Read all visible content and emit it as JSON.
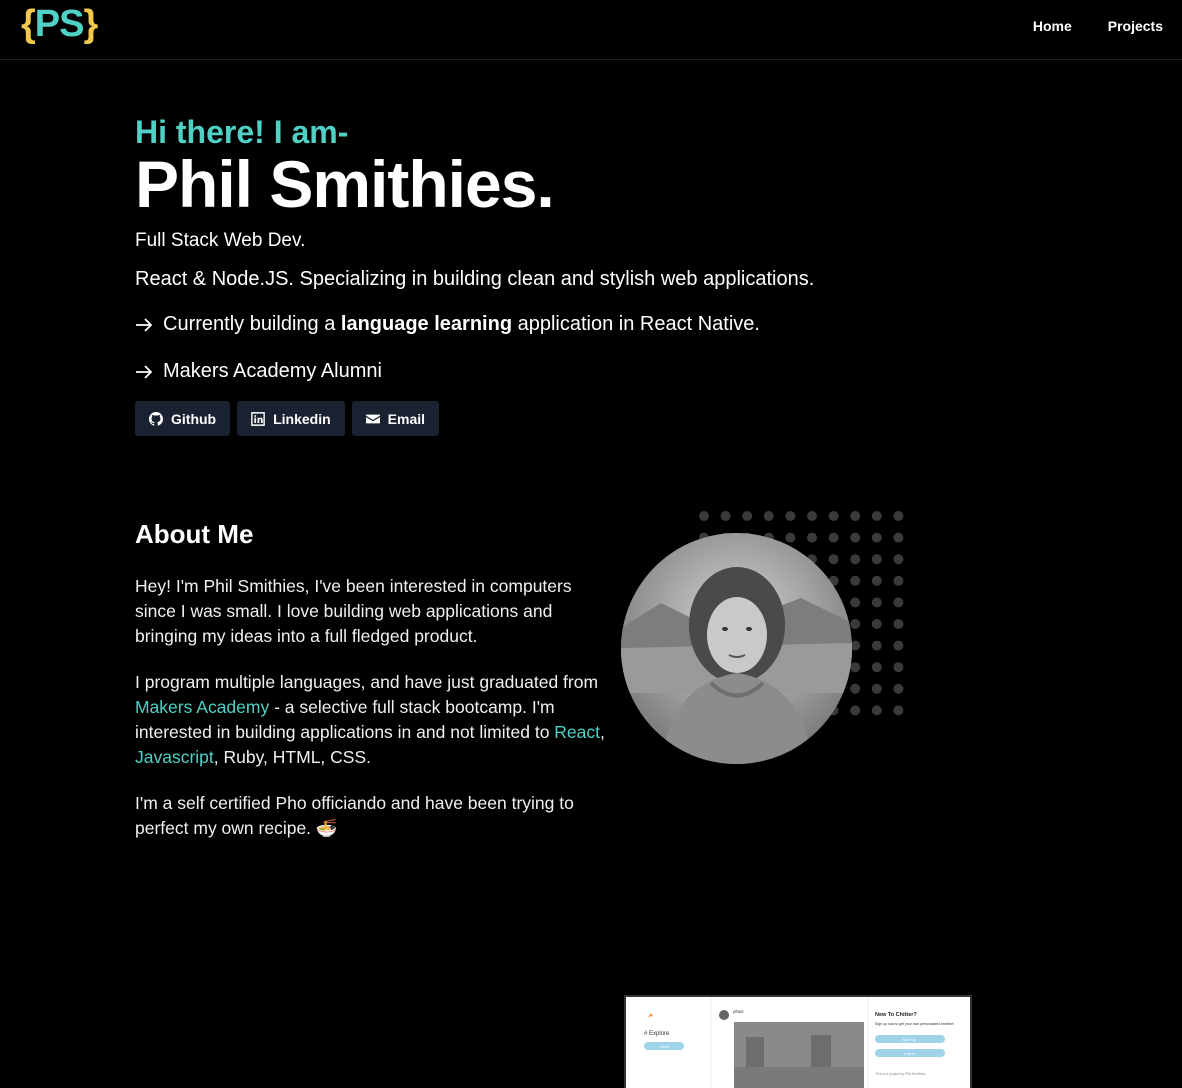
{
  "nav": {
    "logo_open": "{",
    "logo_text": "PS",
    "logo_close": "}",
    "links": [
      "Home",
      "Projects"
    ]
  },
  "hero": {
    "greeting": "Hi there! I am-",
    "name": "Phil Smithies.",
    "role": "Full Stack Web Dev.",
    "tagline": "React & Node.JS. Specializing in building clean and stylish web applications.",
    "bullet1_pre": "Currently building a ",
    "bullet1_bold": "language learning",
    "bullet1_post": " application in React Native.",
    "bullet2": "Makers Academy Alumni",
    "buttons": [
      {
        "label": "Github",
        "icon": "github-icon"
      },
      {
        "label": "Linkedin",
        "icon": "linkedin-icon"
      },
      {
        "label": "Email",
        "icon": "envelope-icon"
      }
    ]
  },
  "about": {
    "title": "About Me",
    "p1": "Hey! I'm Phil Smithies, I've been interested in computers since I was small. I love building web applications and bringing my ideas into a full fledged product.",
    "p2_a": "I program multiple languages, and have just graduated from ",
    "p2_link1": "Makers Academy",
    "p2_b": " - a selective full stack bootcamp. I'm interested in building applications in and not limited to ",
    "p2_link2": "React",
    "p2_c": ", ",
    "p2_link3": "Javascript",
    "p2_d": ", Ruby, HTML, CSS.",
    "p3": "I'm a self certified Pho officiando and have been trying to perfect my own recipe. 🍜"
  },
  "project_preview": {
    "explore": "# Explore",
    "sidebar_button": "Tweet",
    "user": "phaiz",
    "sidebar_title": "New To Chitter?",
    "sidebar_text": "Sign up now to get your own personalized timeline!",
    "signup": "Sign Up",
    "login": "Log In",
    "footer": "This is a project by Phil Smithies."
  },
  "colors": {
    "accent": "#4fd1c5",
    "logo_brace": "#f2c94c",
    "button_bg": "#1a2130"
  }
}
